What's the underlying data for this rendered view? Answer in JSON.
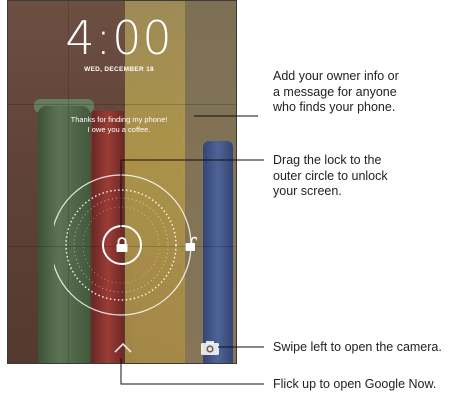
{
  "lockscreen": {
    "time": "4:00",
    "date": "WED, DECEMBER 18",
    "owner_message": [
      "Thanks for finding my phone!",
      "I owe you a coffee."
    ],
    "icons": {
      "lock": "lock-icon",
      "unlock": "unlock-icon",
      "google_now": "chevron-up-icon",
      "camera": "camera-icon"
    },
    "colors": {
      "foreground": "#ffffff"
    }
  },
  "callouts": {
    "owner_info": [
      "Add your owner info or",
      "a message for anyone",
      "who finds your phone."
    ],
    "unlock": [
      "Drag the lock to the",
      "outer circle to unlock",
      "your screen."
    ],
    "camera": [
      "Swipe left to open the camera."
    ],
    "google_now": [
      "Flick up to open Google Now."
    ]
  }
}
